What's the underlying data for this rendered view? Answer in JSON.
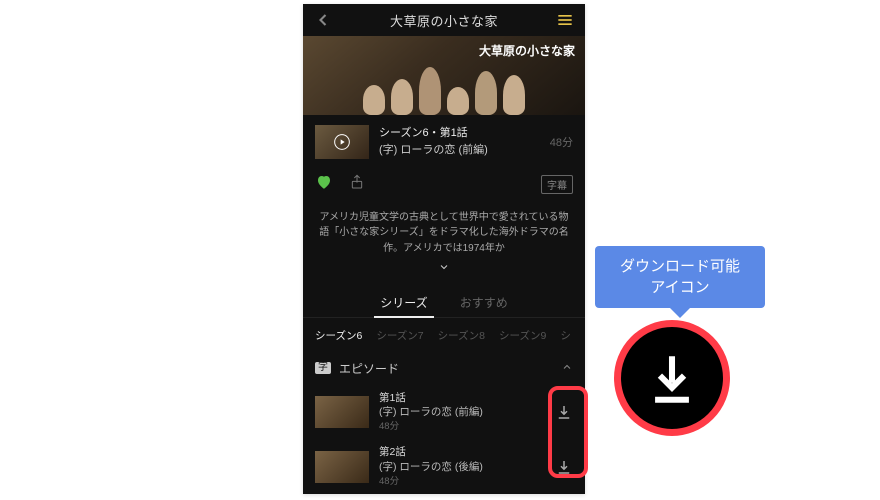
{
  "colors": {
    "highlight": "#ff3b47",
    "speech": "#5b89e6"
  },
  "header": {
    "title": "大草原の小さな家"
  },
  "hero": {
    "overlay_title": "大草原の小さな家"
  },
  "current": {
    "title": "シーズン6・第1話",
    "subtitle": "(字) ローラの恋 (前編)",
    "duration": "48分"
  },
  "badges": {
    "subtitle": "字幕"
  },
  "description": "アメリカ児童文学の古典として世界中で愛されている物語「小さな家シリーズ」をドラマ化した海外ドラマの名作。アメリカでは1974年か",
  "tabs": {
    "series": "シリーズ",
    "recommend": "おすすめ"
  },
  "seasons": [
    "シーズン6",
    "シーズン7",
    "シーズン8",
    "シーズン9",
    "シ"
  ],
  "episode_section": {
    "badge": "字",
    "label": "エピソード"
  },
  "episodes": [
    {
      "num": "第1話",
      "subtitle": "(字) ローラの恋 (前編)",
      "duration": "48分"
    },
    {
      "num": "第2話",
      "subtitle": "(字) ローラの恋 (後編)",
      "duration": "48分"
    }
  ],
  "callout": {
    "line1": "ダウンロード可能",
    "line2": "アイコン"
  }
}
